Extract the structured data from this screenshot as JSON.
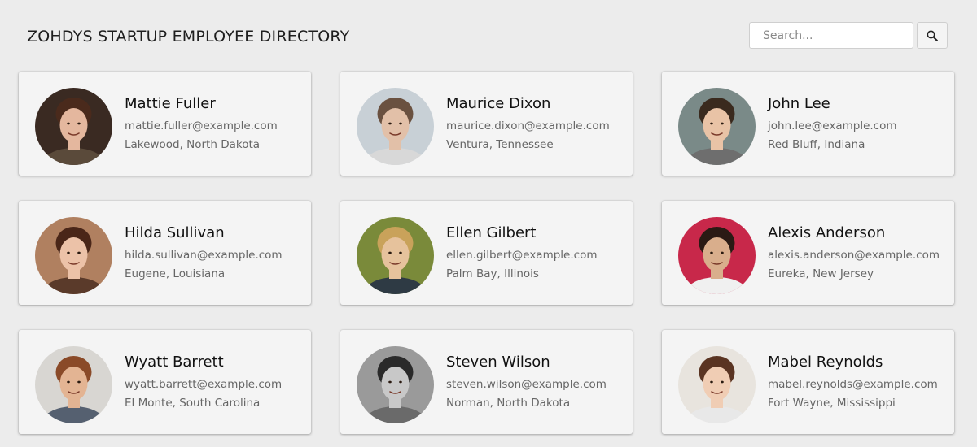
{
  "header": {
    "title": "ZOHDYS STARTUP EMPLOYEE DIRECTORY",
    "search_placeholder": "Search...",
    "search_icon": "magnifier-icon"
  },
  "employees": [
    {
      "name": "Mattie Fuller",
      "email": "mattie.fuller@example.com",
      "location": "Lakewood, North Dakota",
      "avatar": {
        "bg": "#3a2a22",
        "skin": "#e4b79e",
        "hair": "#4a2a1c",
        "shirt": "#5a4a3a"
      }
    },
    {
      "name": "Maurice Dixon",
      "email": "maurice.dixon@example.com",
      "location": "Ventura, Tennessee",
      "avatar": {
        "bg": "#c8d0d6",
        "skin": "#e2c0a8",
        "hair": "#6a5140",
        "shirt": "#d8d8d8"
      }
    },
    {
      "name": "John Lee",
      "email": "john.lee@example.com",
      "location": "Red Bluff, Indiana",
      "avatar": {
        "bg": "#7a8a88",
        "skin": "#e9c3a6",
        "hair": "#3a2a1e",
        "shirt": "#6e6e6e"
      }
    },
    {
      "name": "Hilda Sullivan",
      "email": "hilda.sullivan@example.com",
      "location": "Eugene, Louisiana",
      "avatar": {
        "bg": "#b08060",
        "skin": "#ecc2a8",
        "hair": "#4a2618",
        "shirt": "#5a3a2a"
      }
    },
    {
      "name": "Ellen Gilbert",
      "email": "ellen.gilbert@example.com",
      "location": "Palm Bay, Illinois",
      "avatar": {
        "bg": "#7a8a3a",
        "skin": "#e6c29c",
        "hair": "#c9a25a",
        "shirt": "#2e3a44"
      }
    },
    {
      "name": "Alexis Anderson",
      "email": "alexis.anderson@example.com",
      "location": "Eureka, New Jersey",
      "avatar": {
        "bg": "#c8284a",
        "skin": "#d9ae8c",
        "hair": "#2a1a14",
        "shirt": "#f0f0f0"
      }
    },
    {
      "name": "Wyatt Barrett",
      "email": "wyatt.barrett@example.com",
      "location": "El Monte, South Carolina",
      "avatar": {
        "bg": "#d8d6d2",
        "skin": "#e3b493",
        "hair": "#8a4a28",
        "shirt": "#556070"
      }
    },
    {
      "name": "Steven Wilson",
      "email": "steven.wilson@example.com",
      "location": "Norman, North Dakota",
      "avatar": {
        "bg": "#9a9a9a",
        "skin": "#c8c8c8",
        "hair": "#2a2a2a",
        "shirt": "#6a6a6a"
      }
    },
    {
      "name": "Mabel Reynolds",
      "email": "mabel.reynolds@example.com",
      "location": "Fort Wayne, Mississippi",
      "avatar": {
        "bg": "#e8e4de",
        "skin": "#f0cdb4",
        "hair": "#5a3422",
        "shirt": "#e8e8e8"
      }
    }
  ]
}
